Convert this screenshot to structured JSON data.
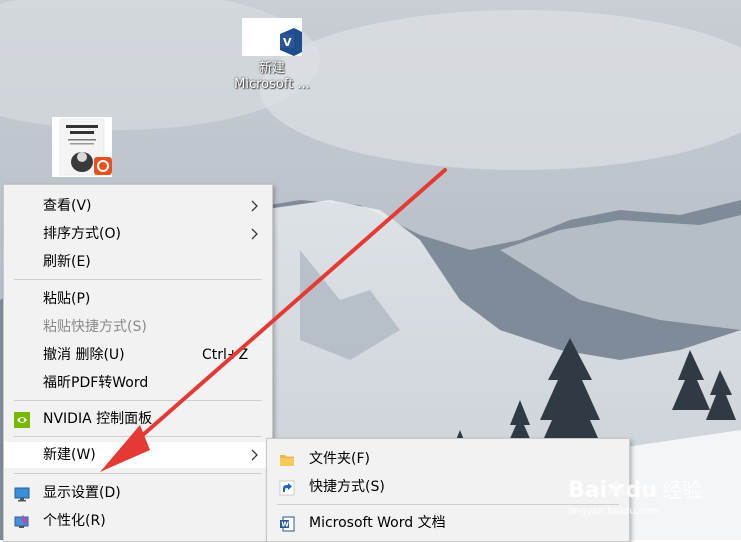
{
  "desktop": {
    "icons": [
      {
        "name": "word-document",
        "label_line1": "新建",
        "label_line2": "Microsoft ..."
      },
      {
        "name": "book-pdf",
        "label_line1": ""
      }
    ]
  },
  "context_menu": {
    "items": [
      {
        "label": "查看(V)",
        "has_submenu": true
      },
      {
        "label": "排序方式(O)",
        "has_submenu": true
      },
      {
        "label": "刷新(E)"
      },
      {
        "label": "粘贴(P)"
      },
      {
        "label": "粘贴快捷方式(S)",
        "disabled": true
      },
      {
        "label": "撤消 删除(U)",
        "shortcut": "Ctrl+Z"
      },
      {
        "label": "福昕PDF转Word"
      },
      {
        "label": "NVIDIA 控制面板",
        "icon": "nvidia-icon"
      },
      {
        "label": "新建(W)",
        "has_submenu": true,
        "highlighted": true
      },
      {
        "label": "显示设置(D)",
        "icon": "display-icon"
      },
      {
        "label": "个性化(R)",
        "icon": "personalize-icon"
      }
    ],
    "arrow_glyph": "〉"
  },
  "submenu": {
    "items": [
      {
        "label": "文件夹(F)",
        "icon": "folder-icon"
      },
      {
        "label": "快捷方式(S)",
        "icon": "shortcut-icon"
      },
      {
        "label": "Microsoft Word 文档",
        "icon": "word-icon"
      }
    ]
  },
  "watermark": {
    "brand_a": "Bai",
    "brand_b": "du",
    "brand_c": "经验",
    "url": "jingyan.baidu.com"
  },
  "colors": {
    "menu_bg": "#f2f2f2",
    "highlight": "#ffffff",
    "arrow_red": "#e53935",
    "word_blue": "#2b579a",
    "nvidia_green": "#76b900"
  }
}
